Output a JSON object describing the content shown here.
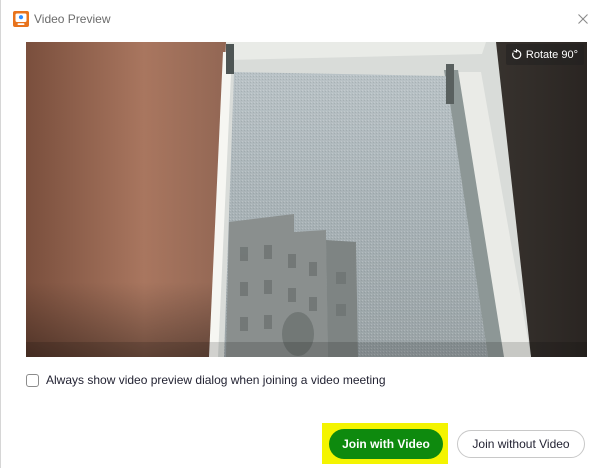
{
  "window": {
    "title": "Video Preview",
    "app_icon": "zoom-app-icon",
    "close_icon": "close-icon"
  },
  "video_preview": {
    "rotate_label": "Rotate 90°",
    "rotate_icon": "rotate-icon"
  },
  "options": {
    "always_show_preview_label": "Always show video preview dialog when joining a video meeting",
    "always_show_preview_checked": false
  },
  "actions": {
    "join_with_video_label": "Join with Video",
    "join_without_video_label": "Join without Video"
  },
  "colors": {
    "join_with_video_bg": "#0e8a0e",
    "highlight": "#f4f400"
  }
}
